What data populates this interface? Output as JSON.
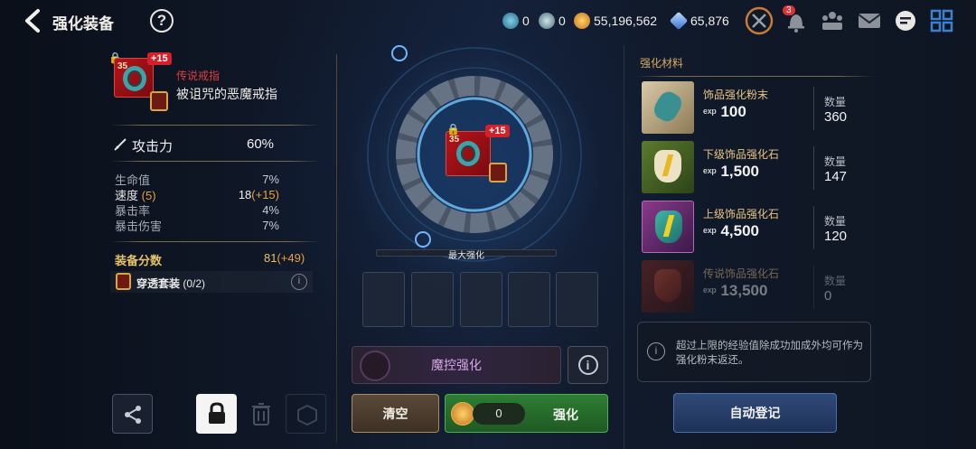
{
  "header": {
    "title": "强化装备",
    "help": "?",
    "currencies": [
      {
        "icon": "blue-key-icon",
        "value": "0"
      },
      {
        "icon": "silver-key-icon",
        "value": "0"
      },
      {
        "icon": "gold-coin-icon",
        "value": "55,196,562"
      },
      {
        "icon": "blue-crystal-icon",
        "value": "65,876"
      }
    ],
    "notification_badge": "3"
  },
  "item": {
    "level": "35",
    "enhance": "+15",
    "rarity": "传说戒指",
    "name": "被诅咒的恶魔戒指",
    "main_stat_label": "攻击力",
    "main_stat_value": "60%",
    "stats": [
      {
        "label": "生命值",
        "value": "7%",
        "bonus": ""
      },
      {
        "label": "速度",
        "label_bonus": "(5)",
        "value": "18",
        "bonus": "(+15)"
      },
      {
        "label": "暴击率",
        "value": "4%",
        "bonus": ""
      },
      {
        "label": "暴击伤害",
        "value": "7%",
        "bonus": ""
      }
    ],
    "score_label": "装备分数",
    "score_value": "81",
    "score_bonus": "(+49)",
    "set_label": "穿透套装",
    "set_progress": "(0/2)"
  },
  "center": {
    "max_label": "最大强化",
    "magic_enhance_label": "魔控强化",
    "clear_label": "清空",
    "cost_value": "0",
    "enhance_label": "强化"
  },
  "materials": {
    "title": "强化材料",
    "qty_label": "数量",
    "items": [
      {
        "name": "饰品强化粉末",
        "exp": "100",
        "qty": "360"
      },
      {
        "name": "下级饰品强化石",
        "exp": "1,500",
        "qty": "147"
      },
      {
        "name": "上级饰品强化石",
        "exp": "4,500",
        "qty": "120"
      },
      {
        "name": "传说饰品强化石",
        "exp": "13,500",
        "qty": "0"
      }
    ],
    "info_text": "超过上限的经验值除成功加成外均可作为强化粉末返还。",
    "auto_register_label": "自动登记"
  },
  "colors": {
    "accent_gold": "#e6c36a",
    "bonus_orange": "#e8a23c",
    "enhance_green": "#2d7a31",
    "item_red": "#b5141a"
  }
}
